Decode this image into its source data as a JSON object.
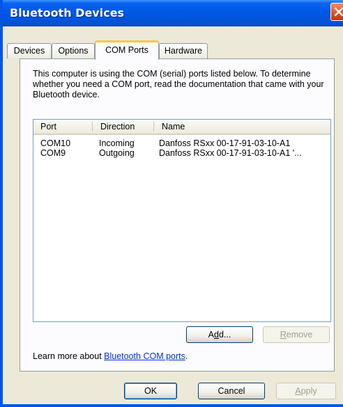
{
  "window": {
    "title": "Bluetooth Devices"
  },
  "tabs": [
    {
      "label": "Devices"
    },
    {
      "label": "Options"
    },
    {
      "label": "COM Ports"
    },
    {
      "label": "Hardware"
    }
  ],
  "active_tab": "COM Ports",
  "description": "This computer is using the COM (serial) ports listed below. To determine whether you need a COM port, read the documentation that came with your Bluetooth device.",
  "list": {
    "columns": [
      "Port",
      "Direction",
      "Name"
    ],
    "rows": [
      {
        "port": "COM10",
        "direction": "Incoming",
        "name": "Danfoss RSxx 00-17-91-03-10-A1"
      },
      {
        "port": "COM9",
        "direction": "Outgoing",
        "name": "Danfoss RSxx 00-17-91-03-10-A1 '..."
      }
    ]
  },
  "buttons": {
    "add": {
      "pre": "A",
      "accel": "d",
      "post": "d..."
    },
    "remove": {
      "pre": "",
      "accel": "R",
      "post": "emove"
    },
    "ok": "OK",
    "cancel": "Cancel",
    "apply": {
      "pre": "",
      "accel": "A",
      "post": "pply"
    }
  },
  "learn_more": {
    "text": "Learn more about ",
    "link": "Bluetooth COM ports",
    "suffix": "."
  },
  "colors": {
    "titlebar": "#0058e6",
    "face": "#ece9d8",
    "tab_highlight": "#ffc83c",
    "link": "#0033cc"
  }
}
